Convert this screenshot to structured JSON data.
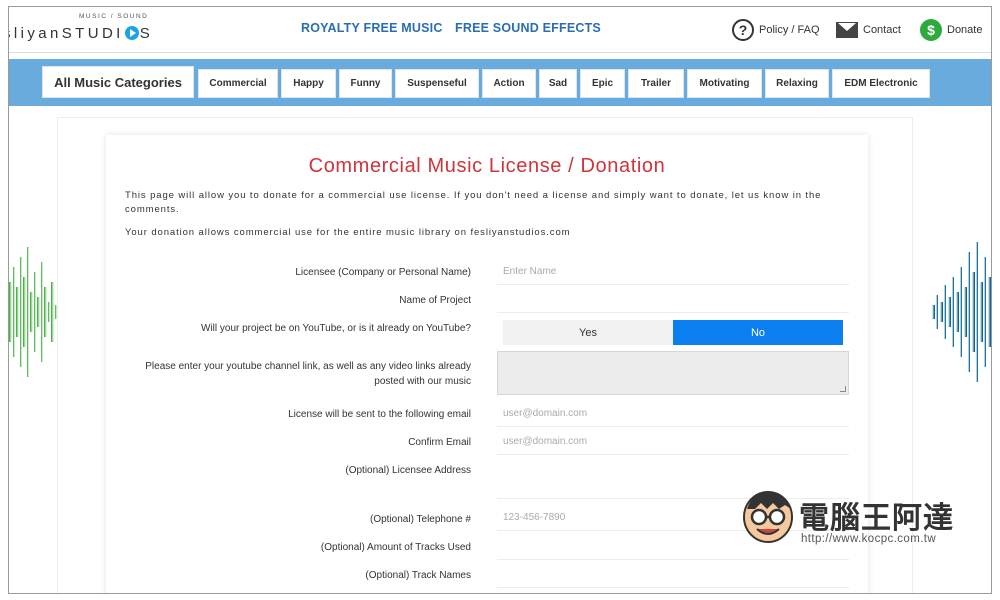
{
  "header": {
    "logo_tagline": "MUSIC / SOUND",
    "logo_text_before": "sliyanSTUDI",
    "logo_text_after": "S",
    "nav": [
      {
        "label": "ROYALTY FREE MUSIC"
      },
      {
        "label": "FREE SOUND EFFECTS"
      }
    ],
    "policy_label": "Policy / FAQ",
    "contact_label": "Contact",
    "donate_label": "Donate",
    "policy_icon_glyph": "?",
    "donate_icon_glyph": "$"
  },
  "categories": [
    "All Music Categories",
    "Commercial",
    "Happy",
    "Funny",
    "Suspenseful",
    "Action",
    "Sad",
    "Epic",
    "Trailer",
    "Motivating",
    "Relaxing",
    "EDM Electronic"
  ],
  "main": {
    "title": "Commercial Music License / Donation",
    "intro": "This page will allow you to donate for a commercial use license. If you don't need a license and simply want to donate, let us know in the comments.",
    "library_note": "Your donation allows commercial use for the entire music library on fesliyanstudios.com"
  },
  "form": {
    "licensee_label": "Licensee (Company or Personal Name)",
    "licensee_placeholder": "Enter Name",
    "project_label": "Name of Project",
    "youtube_label": "Will your project be on YouTube, or is it already on YouTube?",
    "youtube_yes": "Yes",
    "youtube_no": "No",
    "youtube_selected": "No",
    "channel_label_line1": "Please enter your youtube channel link, as well as any video links already",
    "channel_label_line2": "posted with our music",
    "email_label": "License will be sent to the following email",
    "email_placeholder": "user@domain.com",
    "confirm_label": "Confirm Email",
    "confirm_placeholder": "user@domain.com",
    "address_label": "(Optional) Licensee Address",
    "phone_label": "(Optional) Telephone #",
    "phone_placeholder": "123-456-7890",
    "tracks_amount_label": "(Optional) Amount of Tracks Used",
    "track_names_label": "(Optional) Track Names"
  },
  "watermark": {
    "title": "電腦王阿達",
    "url": "http://www.kocpc.com.tw"
  },
  "colors": {
    "accent_blue": "#0b7ff0",
    "category_bar": "#6aabde",
    "title_red": "#d0343a",
    "nav_blue": "#2a6db5",
    "donate_green": "#2eaa3c"
  }
}
